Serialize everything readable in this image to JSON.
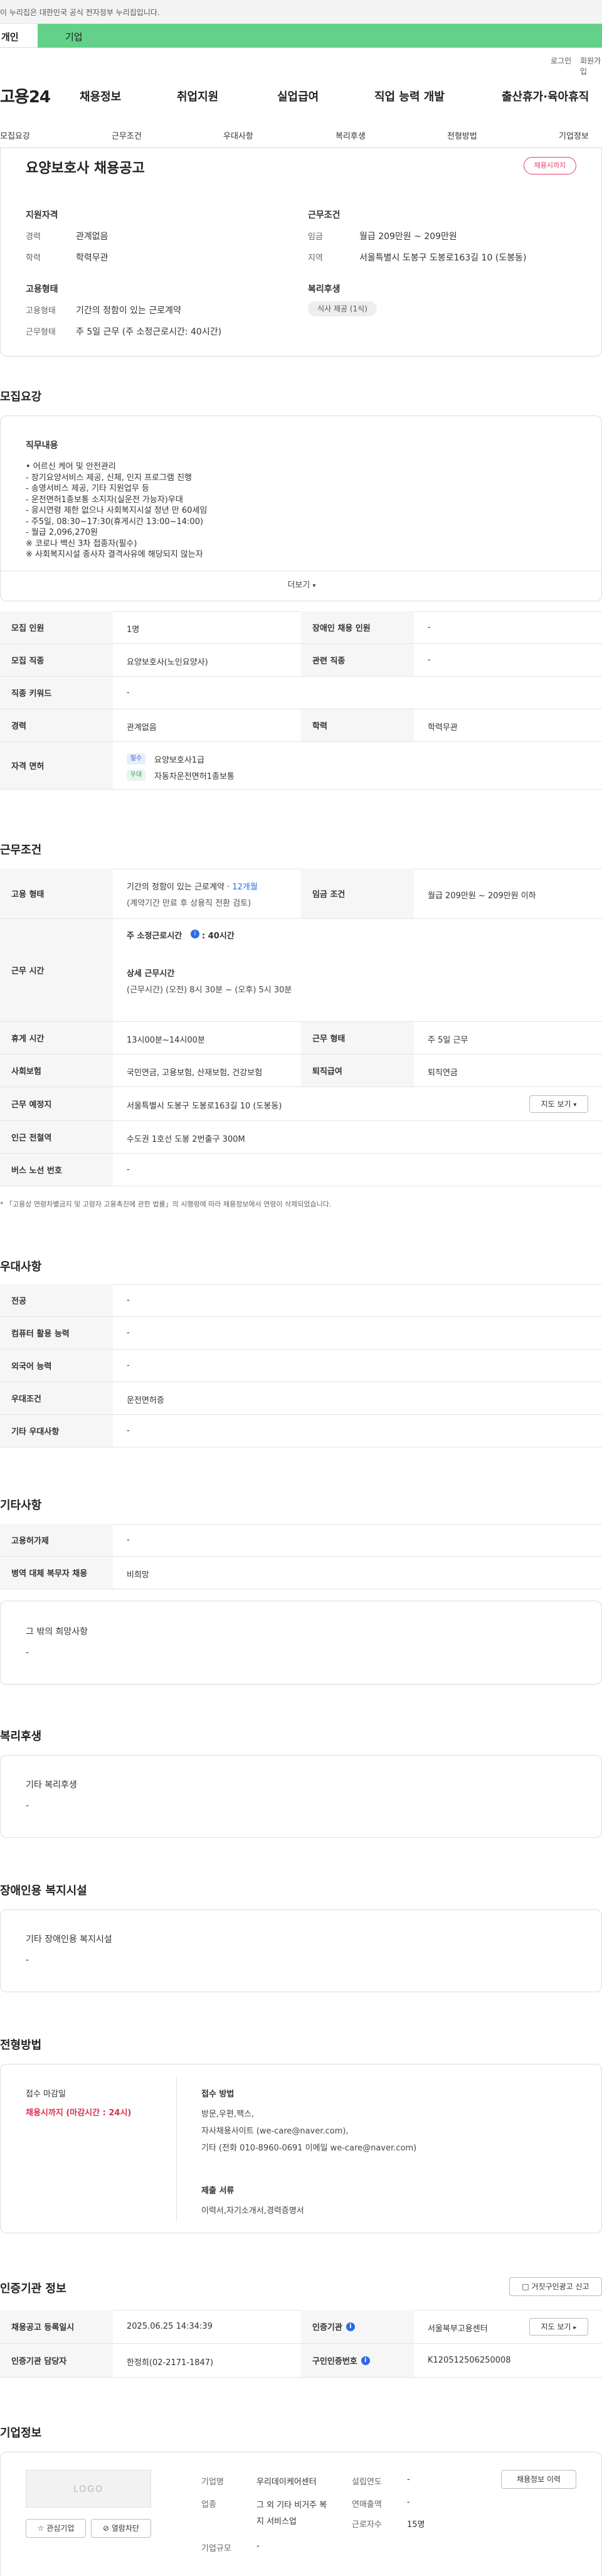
{
  "top": {
    "gov_notice": "이 누리집은 대한민국 공식 전자정부 누리집입니다.",
    "tab_personal": "개인",
    "tab_company": "기업",
    "login": "로그인",
    "join": "회원가입"
  },
  "gnb": {
    "logo": "고용24",
    "menu": [
      "채용정보",
      "취업지원",
      "실업급여",
      "직업 능력 개발",
      "출산휴가·육아휴직"
    ]
  },
  "subnav": [
    "모집요강",
    "근무조건",
    "우대사항",
    "복리후생",
    "전형방법",
    "기업정보"
  ],
  "summary": {
    "title": "요양보호사 채용공고",
    "status_badge": "채용시까지",
    "qual_heading": "지원자격",
    "career_label": "경력",
    "career_value": "관계없음",
    "edu_label": "학력",
    "edu_value": "학력무관",
    "emp_heading": "고용형태",
    "emp_label": "고용형태",
    "emp_value": "기간의 정함이 있는 근로계약",
    "work_label": "근무형태",
    "work_value": "주 5일 근무 (주 소정근로시간: 40시간)",
    "cond_heading": "근무조건",
    "wage_label": "임금",
    "wage_value": "월급 209만원 ~ 209만원",
    "region_label": "지역",
    "region_value": "서울특별시 도봉구 도봉로163길 10 (도봉동)",
    "welfare_heading": "복리후생",
    "welfare_chip": "식사 제공 (1식)"
  },
  "recruit": {
    "section_title": "모집요강",
    "duty_heading": "직무내용",
    "duty_lines": [
      "• 어르신 케어 및 안전관리",
      "- 장기요양서비스 제공, 신체, 인지 프로그램 진행",
      "- 송영서비스 제공, 기타 지원업무 등",
      "- 운전면허1종보통 소지자(실운전 가능자)우대",
      "- 응시연령 제한 없으나 사회복지시설 정년 만 60세임",
      "- 주5일, 08:30~17:30(휴게시간 13:00~14:00)",
      "- 월급 2,096,270원",
      "※ 코로나 백신 3차 접종자(필수)",
      "※ 사회복지시설 종사자 결격사유에 해당되지 않는자"
    ],
    "more_button": "더보기",
    "rows": {
      "headcount_label": "모집 인원",
      "headcount_value": "1명",
      "disabled_label": "장애인 채용 인원",
      "disabled_value": "-",
      "job_label": "모집 직종",
      "job_value": "요양보호사(노인요양사)",
      "related_label": "관련 직종",
      "related_value": "-",
      "keyword_label": "직종 키워드",
      "keyword_value": "-",
      "career_label": "경력",
      "career_value": "관계없음",
      "edu_label": "학력",
      "edu_value": "학력무관",
      "license_label": "자격 면허",
      "license_1_badge": "필수",
      "license_1": "요양보호사1급",
      "license_2_badge": "우대",
      "license_2": "자동차운전면허1종보통"
    }
  },
  "work": {
    "section_title": "근무조건",
    "emp_label": "고용 형태",
    "emp_value": "기간의 정함이 있는 근로계약 · ",
    "emp_months": "12개월",
    "emp_note": "(계약기간 만료 후 상용직 전환 검토)",
    "wage_label": "임금 조건",
    "wage_value": "월급 209만원 ~ 209만원 이하",
    "time_label": "근무 시간",
    "weekly_label": "주 소정근로시간",
    "weekly_value": ": 40시간",
    "detail_label": "상세 근무시간",
    "detail_value": "(근무시간) (오전) 8시 30분 ~ (오후) 5시 30분",
    "rest_label": "휴게 시간",
    "rest_value": "13시00분~14시00분",
    "form_label": "근무 형태",
    "form_value": "주 5일 근무",
    "insurance_label": "사회보험",
    "insurance_value": "국민연금, 고용보험, 산재보험, 건강보험",
    "retire_label": "퇴직급여",
    "retire_value": "퇴직연금",
    "place_label": "근무 예정지",
    "place_value": "서울특별시 도봉구 도봉로163길 10 (도봉동)",
    "map_button": "지도 보기",
    "subway_label": "인근 전철역",
    "subway_value": "수도권 1호선 도봉 2번출구 300M",
    "bus_label": "버스 노선 번호",
    "bus_value": "-",
    "footnote": "「고용상 연령차별금지 및 고령자 고용촉진에 관한 법률」의 시행령에 따라 채용정보에서 연령이 삭제되었습니다."
  },
  "pref": {
    "section_title": "우대사항",
    "rows": [
      {
        "label": "전공",
        "value": "-"
      },
      {
        "label": "컴퓨터 활용 능력",
        "value": "-"
      },
      {
        "label": "외국어 능력",
        "value": "-"
      },
      {
        "label": "우대조건",
        "value": "운전면허증"
      },
      {
        "label": "기타 우대사항",
        "value": "-"
      }
    ]
  },
  "etc": {
    "section_title": "기타사항",
    "rows": [
      {
        "label": "고용허가제",
        "value": "-"
      },
      {
        "label": "병역 대체 복무자 채용",
        "value": "비희망"
      }
    ],
    "box_title": "그 밖의 희망사항",
    "box_value": "-"
  },
  "welfare": {
    "section_title": "복리후생",
    "box_title": "기타 복리후생",
    "box_value": "-"
  },
  "disabled": {
    "section_title": "장애인용 복지시설",
    "box_title": "기타 장애인용 복지시설",
    "box_value": "-"
  },
  "process": {
    "section_title": "전형방법",
    "deadline_heading": "접수 마감일",
    "deadline_value": "채용시까지 (마감시간 : 24시)",
    "method_heading": "접수 방법",
    "method_lines": [
      "방문,우편,팩스,",
      "자사채용사이트 (we-care@naver.com),",
      "기타 (전화 010-8960-0691 이메일 we-care@naver.com)"
    ],
    "docs_heading": "제출 서류",
    "docs_value": "이력서,자기소개서,경력증명서"
  },
  "agency": {
    "section_title": "인증기관 정보",
    "report_button": "거짓구인광고 신고",
    "reg_label": "채용공고 등록일시",
    "reg_value": "2025.06.25 14:34:39",
    "agency_label": "인증기관",
    "agency_value": "서울북부고용센터",
    "map_button": "지도 보기",
    "manager_label": "인증기관 담당자",
    "manager_value": "한정희(02-2171-1847)",
    "cert_label": "구인인증번호",
    "cert_value": "K120512506250008"
  },
  "company": {
    "section_title": "기업정보",
    "logo_text": "LOGO",
    "fav_button": "관심기업",
    "block_button": "열람차단",
    "history_button": "채용정보 이력",
    "name_label": "기업명",
    "name_value": "우리데이케어센터",
    "industry_label": "업종",
    "industry_value": "그 외 기타 비거주 복지 서비스업",
    "scale_label": "기업규모",
    "scale_value": "-",
    "year_label": "설립연도",
    "year_value": "-",
    "sales_label": "연매출액",
    "sales_value": "-",
    "staff_label": "근로자수",
    "staff_value": "15명"
  }
}
